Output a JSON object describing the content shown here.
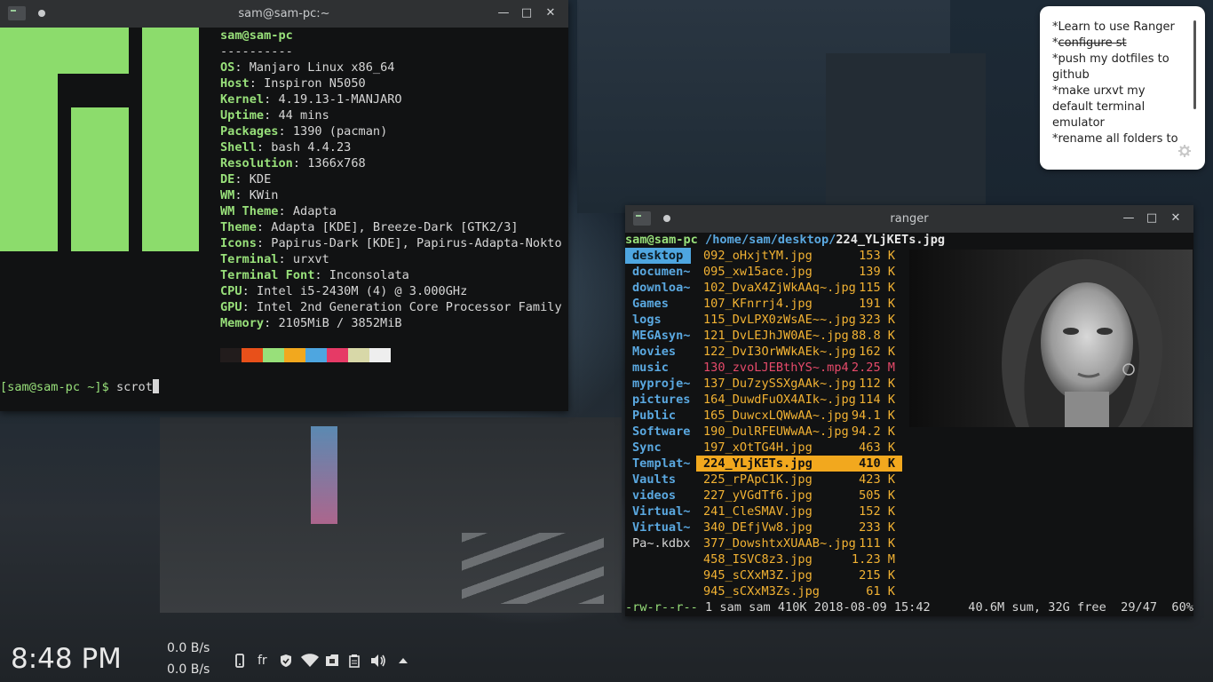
{
  "terminal": {
    "title": "sam@sam-pc:~",
    "header": "sam@sam-pc",
    "separator": "----------",
    "info": [
      {
        "key": "OS",
        "value": "Manjaro Linux x86_64"
      },
      {
        "key": "Host",
        "value": "Inspiron N5050"
      },
      {
        "key": "Kernel",
        "value": "4.19.13-1-MANJARO"
      },
      {
        "key": "Uptime",
        "value": "44 mins"
      },
      {
        "key": "Packages",
        "value": "1390 (pacman)"
      },
      {
        "key": "Shell",
        "value": "bash 4.4.23"
      },
      {
        "key": "Resolution",
        "value": "1366x768"
      },
      {
        "key": "DE",
        "value": "KDE"
      },
      {
        "key": "WM",
        "value": "KWin"
      },
      {
        "key": "WM Theme",
        "value": "Adapta"
      },
      {
        "key": "Theme",
        "value": "Adapta [KDE], Breeze-Dark [GTK2/3]"
      },
      {
        "key": "Icons",
        "value": "Papirus-Dark [KDE], Papirus-Adapta-Nokto"
      },
      {
        "key": "Terminal",
        "value": "urxvt"
      },
      {
        "key": "Terminal Font",
        "value": "Inconsolata"
      },
      {
        "key": "CPU",
        "value": "Intel i5-2430M (4) @ 3.000GHz"
      },
      {
        "key": "GPU",
        "value": "Intel 2nd Generation Core Processor Family"
      },
      {
        "key": "Memory",
        "value": "2105MiB / 3852MiB"
      }
    ],
    "palette": [
      "#221c1c",
      "#e8501a",
      "#98e07a",
      "#f2a81e",
      "#4ea6e0",
      "#e63a66",
      "#d8d8a8",
      "#eeeeee"
    ],
    "prompt": "[sam@sam-pc ~]$",
    "command": "scrot"
  },
  "ranger": {
    "title": "ranger",
    "user": "sam@sam-pc",
    "path": "/home/sam/desktop/",
    "current_file": "224_YLjKETs.jpg",
    "dirs": [
      "desktop",
      "documen~",
      "downloa~",
      "Games",
      "logs",
      "MEGAsyn~",
      "Movies",
      "music",
      "myproje~",
      "pictures",
      "Public",
      "Software",
      "Sync",
      "Templat~",
      "Vaults",
      "videos",
      "Virtual~",
      "Virtual~",
      "Pa~.kdbx"
    ],
    "files": [
      {
        "name": "092_oHxjtYM.jpg",
        "size": "153 K"
      },
      {
        "name": "095_xw15ace.jpg",
        "size": "139 K"
      },
      {
        "name": "102_DvaX4ZjWkAAq~.jpg",
        "size": "115 K"
      },
      {
        "name": "107_KFnrrj4.jpg",
        "size": "191 K"
      },
      {
        "name": "115_DvLPX0zWsAE~~.jpg",
        "size": "323 K"
      },
      {
        "name": "121_DvLEJhJW0AE~.jpg",
        "size": "88.8 K"
      },
      {
        "name": "122_DvI3OrWWkAEk~.jpg",
        "size": "162 K"
      },
      {
        "name": "130_zvoLJEBthYS~.mp4",
        "size": "2.25 M"
      },
      {
        "name": "137_Du7zySSXgAAk~.jpg",
        "size": "112 K"
      },
      {
        "name": "164_DuwdFuOX4AIk~.jpg",
        "size": "114 K"
      },
      {
        "name": "165_DuwcxLQWwAA~.jpg",
        "size": "94.1 K"
      },
      {
        "name": "190_DulRFEUWwAA~.jpg",
        "size": "94.2 K"
      },
      {
        "name": "197_xOtTG4H.jpg",
        "size": "463 K"
      },
      {
        "name": "224_YLjKETs.jpg",
        "size": "410 K"
      },
      {
        "name": "225_rPApC1K.jpg",
        "size": "423 K"
      },
      {
        "name": "227_yVGdTf6.jpg",
        "size": "505 K"
      },
      {
        "name": "241_CleSMAV.jpg",
        "size": "152 K"
      },
      {
        "name": "340_DEfjVw8.jpg",
        "size": "233 K"
      },
      {
        "name": "377_DowshtxXUAAB~.jpg",
        "size": "111 K"
      },
      {
        "name": "458_ISVC8z3.jpg",
        "size": "1.23 M"
      },
      {
        "name": "945_sCXxM3Z.jpg",
        "size": "215 K"
      },
      {
        "name": "945_sCXxM3Zs.jpg",
        "size": "61 K"
      }
    ],
    "status_perm": "-rw-r--r--",
    "status_info": "1 sam sam 410K 2018-08-09 15:42",
    "status_right": "40.6M sum, 32G free  29/47  60%"
  },
  "note": {
    "lines": [
      {
        "text": "*Learn to use Ranger",
        "strike": false
      },
      {
        "text": "*",
        "strike": false,
        "suffix": "configure st"
      },
      {
        "text": "*push my dotfiles to github",
        "strike": false
      },
      {
        "text": "*make urxvt my default terminal emulator",
        "strike": false
      },
      {
        "text": "*rename all folders to",
        "strike": false
      }
    ]
  },
  "panel": {
    "clock": "8:48 PM",
    "net_up": "0.0 B/s",
    "net_down": "0.0 B/s",
    "lang": "fr"
  }
}
